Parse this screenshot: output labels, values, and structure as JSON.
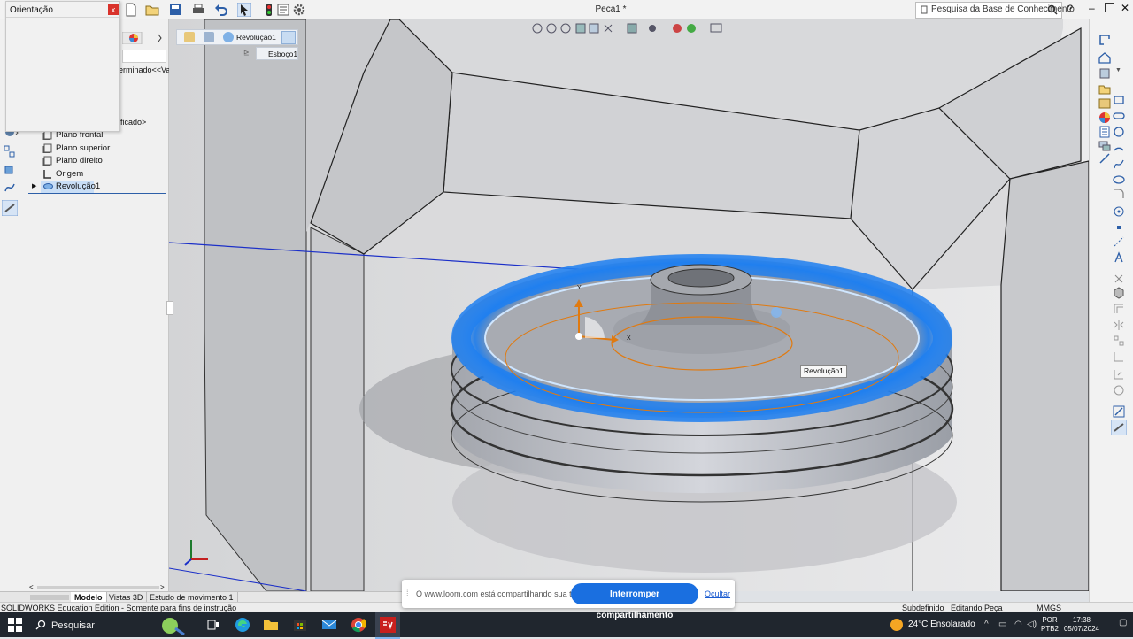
{
  "window": {
    "title": "Peca1 *",
    "search_placeholder": "Pesquisa da Base de Conhecimento",
    "help_label": "?"
  },
  "orientation_panel": {
    "title": "Orientação",
    "close_label": "x"
  },
  "feature_tree": {
    "partial_labels": [
      "erminado<<Va",
      "ificado>"
    ],
    "items": [
      {
        "label": "Plano frontal",
        "icon": "plane-icon"
      },
      {
        "label": "Plano superior",
        "icon": "plane-icon"
      },
      {
        "label": "Plano direito",
        "icon": "plane-icon"
      },
      {
        "label": "Origem",
        "icon": "origin-icon"
      },
      {
        "label": "Revolução1",
        "icon": "revolve-icon",
        "selected": true
      }
    ]
  },
  "breadcrumb": {
    "feature": "Revolução1",
    "sketch": "Esboço1"
  },
  "viewport": {
    "callout": "Revolução1",
    "triad_labels": [
      "Y",
      "X"
    ]
  },
  "bottom_tabs": [
    "Modelo",
    "Vistas 3D",
    "Estudo de movimento 1"
  ],
  "status_bar": {
    "edition": "SOLIDWORKS Education Edition - Somente para fins de instrução",
    "state": "Subdefinido",
    "mode": "Editando Peça",
    "units": "MMGS"
  },
  "share_bar": {
    "message": "O www.loom.com está compartilhando sua tela.",
    "stop_label": "Interromper compartilhamento",
    "hide_label": "Ocultar"
  },
  "taskbar": {
    "search_label": "Pesquisar",
    "weather": "24°C  Ensolarado",
    "lang_line1": "POR",
    "lang_line2": "PTB2",
    "time": "17:38",
    "date": "05/07/2024"
  },
  "colors": {
    "highlight_blue": "#1e7ff0",
    "sketch_orange": "#e07a10",
    "taskbar": "#20262e",
    "share_button": "#1a6fe0"
  }
}
